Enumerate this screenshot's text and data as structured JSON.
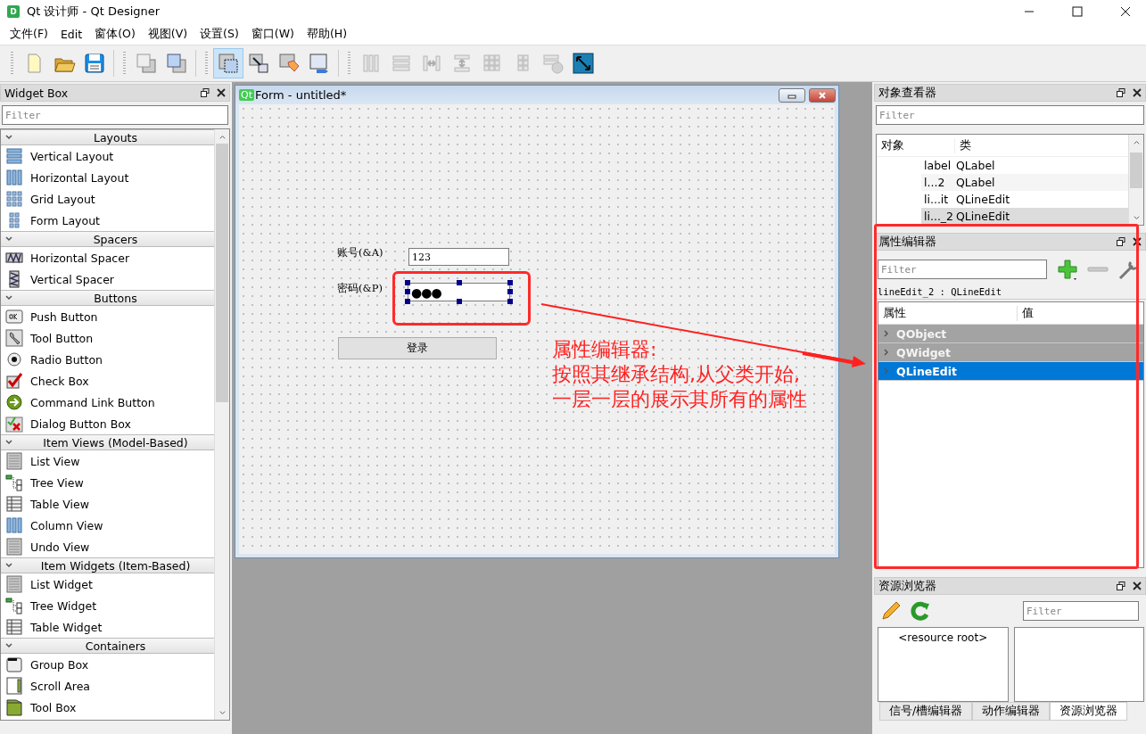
{
  "window": {
    "logo": "D",
    "title": "Qt 设计师 - Qt Designer"
  },
  "menu": [
    "文件(F)",
    "Edit",
    "窗体(O)",
    "视图(V)",
    "设置(S)",
    "窗口(W)",
    "帮助(H)"
  ],
  "toolbar": {
    "edit_modes": [
      {
        "selected": true
      },
      {
        "selected": false
      },
      {
        "selected": false
      },
      {
        "selected": false
      }
    ],
    "layout_actions": [
      {
        "disabled": true
      },
      {
        "disabled": true
      },
      {
        "disabled": true
      },
      {
        "disabled": true
      },
      {
        "disabled": true
      },
      {
        "disabled": true
      },
      {
        "disabled": true
      },
      {
        "disabled": false
      }
    ]
  },
  "widget_box": {
    "title": "Widget Box",
    "filter_placeholder": "Filter",
    "categories": [
      {
        "name": "Layouts",
        "expanded": true,
        "items": [
          "Vertical Layout",
          "Horizontal Layout",
          "Grid Layout",
          "Form Layout"
        ]
      },
      {
        "name": "Spacers",
        "expanded": true,
        "items": [
          "Horizontal Spacer",
          "Vertical Spacer"
        ]
      },
      {
        "name": "Buttons",
        "expanded": true,
        "items": [
          "Push Button",
          "Tool Button",
          "Radio Button",
          "Check Box",
          "Command Link Button",
          "Dialog Button Box"
        ]
      },
      {
        "name": "Item Views (Model-Based)",
        "expanded": true,
        "items": [
          "List View",
          "Tree View",
          "Table View",
          "Column View",
          "Undo View"
        ]
      },
      {
        "name": "Item Widgets (Item-Based)",
        "expanded": true,
        "items": [
          "List Widget",
          "Tree Widget",
          "Table Widget"
        ]
      },
      {
        "name": "Containers",
        "expanded": true,
        "items": [
          "Group Box",
          "Scroll Area",
          "Tool Box"
        ]
      }
    ]
  },
  "form": {
    "logo": "Qt",
    "title": "Form - untitled*",
    "account_label": "账号(&A)",
    "account_value": "123",
    "password_label": "密码(&P)",
    "password_value": "●●●",
    "password_selected": true,
    "login_button": "登录"
  },
  "object_inspector": {
    "title": "对象查看器",
    "filter_placeholder": "Filter",
    "columns": [
      "对象",
      "类"
    ],
    "rows": [
      {
        "object": "label",
        "class": "QLabel",
        "selected": false
      },
      {
        "object": "l...2",
        "class": "QLabel",
        "selected": false
      },
      {
        "object": "li...it",
        "class": "QLineEdit",
        "selected": false
      },
      {
        "object": "li..._2",
        "class": "QLineEdit",
        "selected": true
      }
    ]
  },
  "property_editor": {
    "title": "属性编辑器",
    "filter_placeholder": "Filter",
    "current": "lineEdit_2 : QLineEdit",
    "columns": [
      "属性",
      "值"
    ],
    "groups": [
      {
        "name": "QObject",
        "expanded": false,
        "selected": false
      },
      {
        "name": "QWidget",
        "expanded": false,
        "selected": false
      },
      {
        "name": "QLineEdit",
        "expanded": false,
        "selected": true
      }
    ]
  },
  "resource_browser": {
    "title": "资源浏览器",
    "filter_placeholder": "Filter",
    "root": "<resource root>"
  },
  "bottom_tabs": [
    {
      "label": "信号/槽编辑器",
      "selected": false
    },
    {
      "label": "动作编辑器",
      "selected": false
    },
    {
      "label": "资源浏览器",
      "selected": true
    }
  ],
  "annotation": {
    "lines": [
      "属性编辑器:",
      "按照其继承结构,从父类开始,",
      "一层一层的展示其所有的属性"
    ]
  }
}
